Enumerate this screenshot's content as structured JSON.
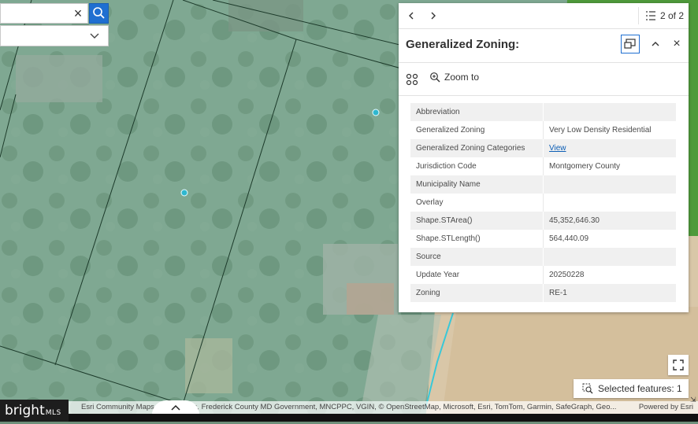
{
  "map": {
    "colors": {
      "overlay": "#7fa892",
      "field": "#d9c7a8",
      "grass": "#4f9a3b",
      "highlight": "#38c8d8"
    },
    "search": {
      "value": "",
      "clear_icon": "close-icon",
      "button_icon": "search-icon"
    },
    "layer_select": {
      "value": "",
      "icon": "chevron-down-icon"
    }
  },
  "popup": {
    "pager_text": "2 of 2",
    "title": "Generalized Zoning:",
    "zoom_label": "Zoom to",
    "attributes": [
      {
        "key": "Abbreviation",
        "value": ""
      },
      {
        "key": "Generalized Zoning",
        "value": "Very Low Density Residential"
      },
      {
        "key": "Generalized Zoning Categories",
        "value": "View",
        "is_link": true
      },
      {
        "key": "Jurisdiction Code",
        "value": "Montgomery County"
      },
      {
        "key": "Municipality Name",
        "value": ""
      },
      {
        "key": "Overlay",
        "value": ""
      },
      {
        "key": "Shape.STArea()",
        "value": "45,352,646.30"
      },
      {
        "key": "Shape.STLength()",
        "value": "564,440.09"
      },
      {
        "key": "Source",
        "value": ""
      },
      {
        "key": "Update Year",
        "value": "20250228"
      },
      {
        "key": "Zoning",
        "value": "RE-1"
      }
    ]
  },
  "controls": {
    "selected_features": "Selected features: 1"
  },
  "attribution": {
    "text": "Esri Community Maps Contributors, Frederick County MD Government, MNCPPC, VGIN, © OpenStreetMap, Microsoft, Esri, TomTom, Garmin, SafeGraph, Geo...",
    "powered": "Powered by Esri"
  },
  "brand": {
    "name": "bright",
    "suffix": "MLS"
  }
}
